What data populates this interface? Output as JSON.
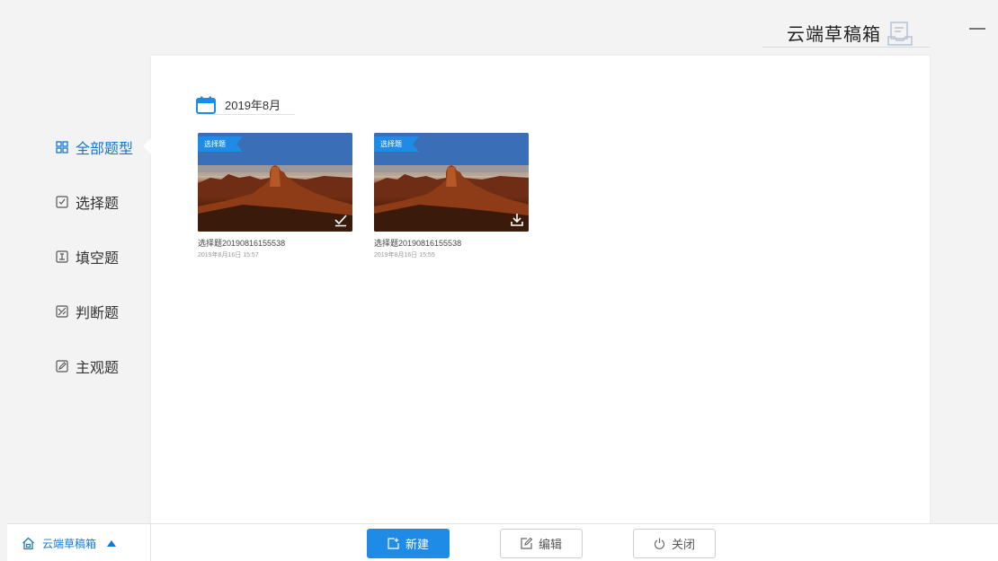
{
  "header": {
    "title": "云端草稿箱",
    "icon": "draft-box-icon"
  },
  "window": {
    "minimize_icon": "minimize-icon"
  },
  "sidebar": {
    "items": [
      {
        "label": "全部题型",
        "icon": "grid-icon",
        "active": true
      },
      {
        "label": "选择题",
        "icon": "choice-icon",
        "active": false
      },
      {
        "label": "填空题",
        "icon": "fill-blank-icon",
        "active": false
      },
      {
        "label": "判断题",
        "icon": "judge-icon",
        "active": false
      },
      {
        "label": "主观题",
        "icon": "subjective-icon",
        "active": false
      }
    ]
  },
  "main": {
    "date_group": {
      "label": "2019年8月",
      "icon": "calendar-icon"
    },
    "cards": [
      {
        "tag": "选择题",
        "name": "选择题20190816155538",
        "time": "2019年8月16日 15:57",
        "corner_icon": "check-icon"
      },
      {
        "tag": "选择题",
        "name": "选择题20190816155538",
        "time": "2019年8月16日 15:55",
        "corner_icon": "download-icon"
      }
    ]
  },
  "footer": {
    "location_label": "云端草稿箱",
    "new_label": "新建",
    "edit_label": "编辑",
    "close_label": "关闭"
  },
  "colors": {
    "accent": "#1e8be6",
    "text_active": "#1677d2",
    "panel_bg": "#ffffff",
    "page_bg": "#f3f3f3"
  }
}
